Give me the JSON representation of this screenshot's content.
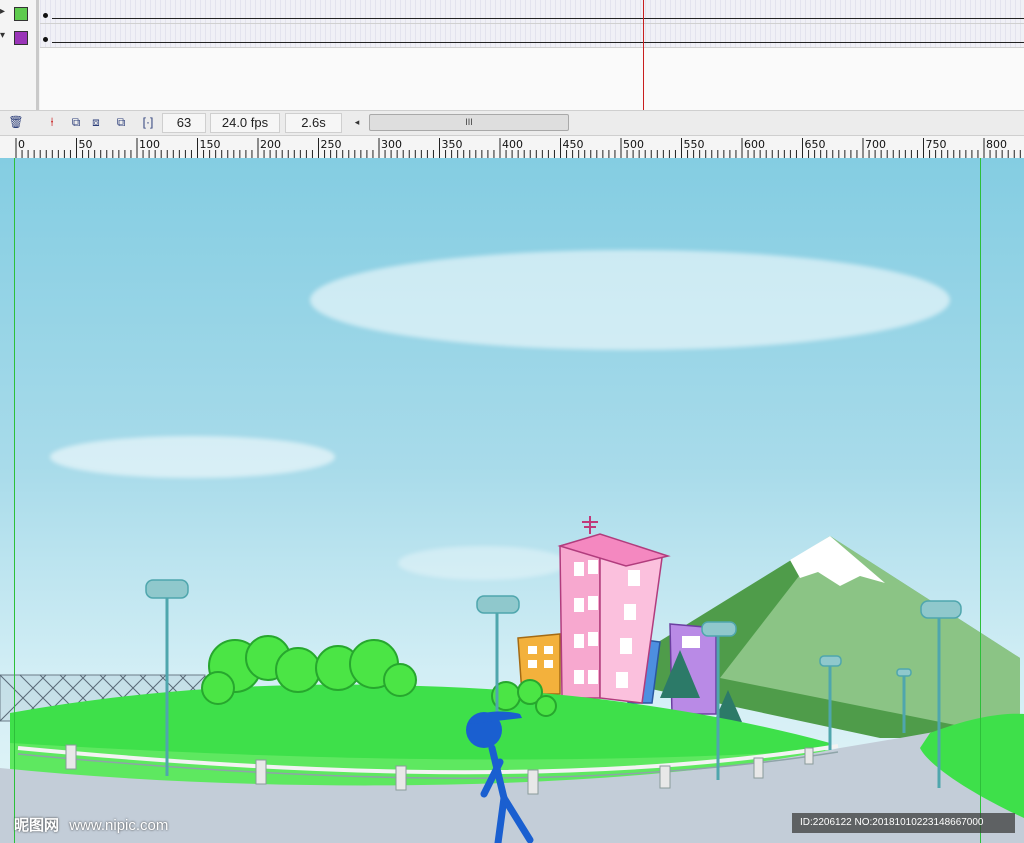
{
  "timeline": {
    "layers": [
      {
        "color": "#5ecb4e"
      },
      {
        "color": "#9a35b8"
      }
    ],
    "current_frame": 63,
    "playhead_frame_label": ""
  },
  "toolbar": {
    "frame": "63",
    "fps": "24.0 fps",
    "time": "2.6s",
    "scroll_thumb": "III",
    "icons": [
      "delete-layer-icon",
      "center-frame-icon",
      "onion-skin-icon",
      "onion-skin-outlines-icon",
      "edit-multiple-frames-icon",
      "modify-onion-markers-icon"
    ]
  },
  "ruler": {
    "labels": [
      "0",
      "50",
      "100",
      "150",
      "200",
      "250",
      "300",
      "350",
      "400",
      "450",
      "500",
      "550",
      "600",
      "650",
      "700",
      "750",
      "800"
    ]
  },
  "watermark": {
    "left_brand": "昵图网",
    "left_site": "www.nipic.com",
    "right_id": "ID:2206122 NO:20181010223148667000"
  },
  "colors": {
    "accent": "#c81e1e",
    "guide": "#2dbf3a",
    "figure": "#1a5fd0"
  }
}
